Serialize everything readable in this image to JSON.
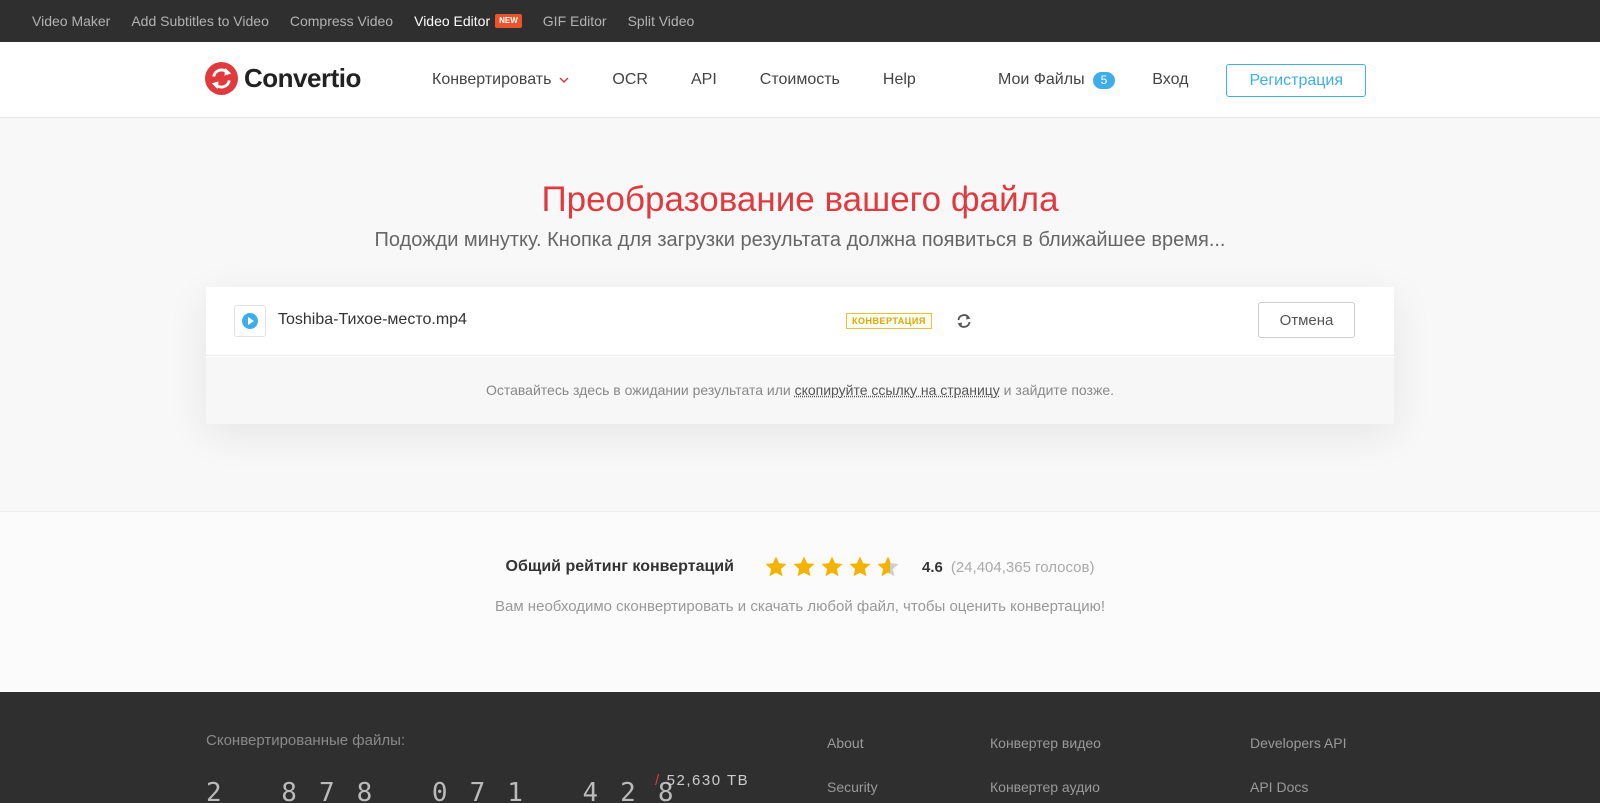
{
  "topbar": {
    "links": [
      "Video Maker",
      "Add Subtitles to Video",
      "Compress Video",
      "Video Editor",
      "GIF Editor",
      "Split Video"
    ],
    "new_badge": "NEW"
  },
  "header": {
    "logo_text": "Convertio",
    "nav": [
      "Конвертировать",
      "OCR",
      "API",
      "Стоимость",
      "Help"
    ],
    "my_files_label": "Мои Файлы",
    "my_files_count": "5",
    "login_label": "Вход",
    "register_label": "Регистрация"
  },
  "main": {
    "title": "Преобразование вашего файла",
    "subtitle": "Подожди минутку. Кнопка для загрузки результата должна появиться в ближайшее время...",
    "file": {
      "name": "Toshiba-Тихое-место.mp4",
      "status": "КОНВЕРТАЦИЯ",
      "cancel_label": "Отмена"
    },
    "note": {
      "before": "Оставайтесь здесь в ожидании результата или ",
      "link": "скопируйте ссылку на страницу",
      "after": " и зайдите позже."
    }
  },
  "rating": {
    "label": "Общий рейтинг конвертаций",
    "value": "4.6",
    "stars_value": 4.6,
    "stars_max": 5,
    "votes": "(24,404,365 голосов)",
    "hint": "Вам необходимо сконвертировать и скачать любой файл, чтобы оценить конвертацию!"
  },
  "footer": {
    "converted_label": "Сконвертированные файлы:",
    "counter": "2 878 071 428",
    "tb": "52,630 TB",
    "col1": [
      "About",
      "Security"
    ],
    "col2": [
      "Конвертер видео",
      "Конвертер аудио"
    ],
    "col3": [
      "Developers API",
      "API Docs"
    ]
  },
  "colors": {
    "brand_red": "#e03a3e",
    "accent_blue": "#3daee9",
    "status_yellow": "#e6c23a",
    "star_gold": "#f5b301"
  }
}
